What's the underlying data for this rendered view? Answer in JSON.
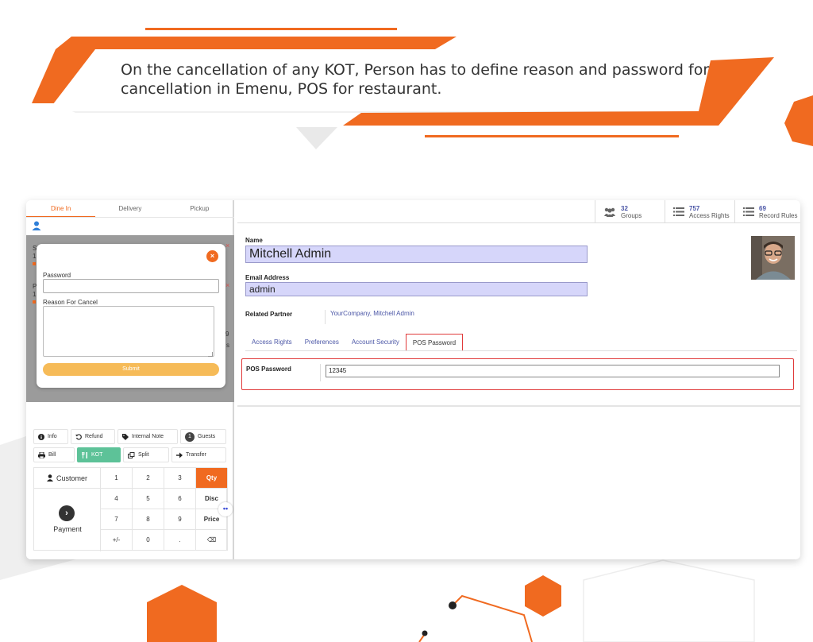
{
  "banner": {
    "text": "On the cancellation of any KOT, Person has to define reason and password for cancellation in Emenu, POS for restaurant."
  },
  "colors": {
    "accent": "#f06a20",
    "submit": "#f6bb58",
    "kot": "#5dc298",
    "highlight": "#e03a3a",
    "field_bg": "#d6d6fa"
  },
  "pos": {
    "tabs": [
      {
        "label": "Dine In",
        "active": true
      },
      {
        "label": "Delivery",
        "active": false
      },
      {
        "label": "Pickup",
        "active": false
      }
    ],
    "modal": {
      "password_label": "Password",
      "reason_label": "Reason For Cancel",
      "submit_label": "Submit",
      "close_icon": "×"
    },
    "actions": {
      "info": "Info",
      "refund": "Refund",
      "internal_note": "Internal Note",
      "guests_count": "1",
      "guests": "Guests",
      "bill": "Bill",
      "kot": "KOT",
      "split": "Split",
      "transfer": "Transfer"
    },
    "numpad": {
      "customer": "Customer",
      "payment": "Payment",
      "keys": [
        "1",
        "2",
        "3",
        "Qty",
        "4",
        "5",
        "6",
        "Disc",
        "7",
        "8",
        "9",
        "Price",
        "+/-",
        "0",
        ".",
        "⌫"
      ]
    }
  },
  "form": {
    "stats": [
      {
        "count": "32",
        "label": "Groups",
        "icon": "users-icon"
      },
      {
        "count": "757",
        "label": "Access Rights",
        "icon": "list-icon"
      },
      {
        "count": "69",
        "label": "Record Rules",
        "icon": "list-icon"
      }
    ],
    "name_label": "Name",
    "name_value": "Mitchell Admin",
    "email_label": "Email Address",
    "email_value": "admin",
    "partner_label": "Related Partner",
    "partner_value": "YourCompany, Mitchell Admin",
    "tabs": [
      {
        "label": "Access Rights",
        "active": false
      },
      {
        "label": "Preferences",
        "active": false
      },
      {
        "label": "Account Security",
        "active": false
      },
      {
        "label": "POS Password",
        "active": true
      }
    ],
    "pos_password_label": "POS Password",
    "pos_password_value": "12345"
  }
}
